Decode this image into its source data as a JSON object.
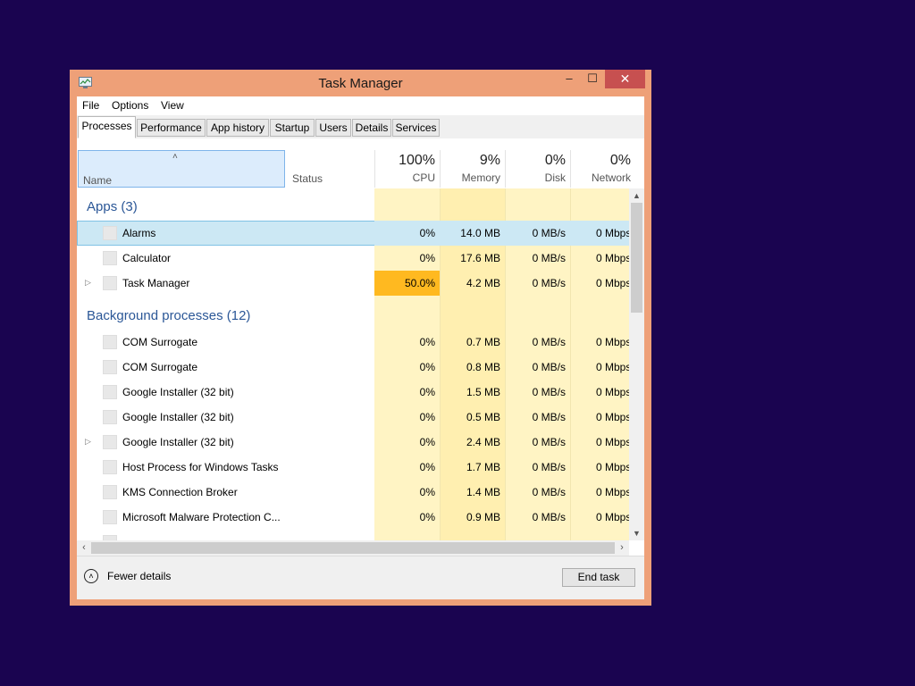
{
  "window": {
    "title": "Task Manager",
    "minimize_glyph": "‒",
    "maximize_glyph": "☐",
    "close_glyph": "✕"
  },
  "menu": [
    "File",
    "Options",
    "View"
  ],
  "tabs": [
    "Processes",
    "Performance",
    "App history",
    "Startup",
    "Users",
    "Details",
    "Services"
  ],
  "columns": {
    "name": "Name",
    "status": "Status",
    "cpu": {
      "pct": "100%",
      "label": "CPU"
    },
    "memory": {
      "pct": "9%",
      "label": "Memory"
    },
    "disk": {
      "pct": "0%",
      "label": "Disk"
    },
    "network": {
      "pct": "0%",
      "label": "Network"
    }
  },
  "groups": {
    "apps": "Apps (3)",
    "background": "Background processes (12)"
  },
  "apps": [
    {
      "name": "Alarms",
      "cpu": "0%",
      "mem": "14.0 MB",
      "disk": "0 MB/s",
      "net": "0 Mbps"
    },
    {
      "name": "Calculator",
      "cpu": "0%",
      "mem": "17.6 MB",
      "disk": "0 MB/s",
      "net": "0 Mbps"
    },
    {
      "name": "Task Manager",
      "cpu": "50.0%",
      "mem": "4.2 MB",
      "disk": "0 MB/s",
      "net": "0 Mbps"
    }
  ],
  "background": [
    {
      "name": "COM Surrogate",
      "cpu": "0%",
      "mem": "0.7 MB",
      "disk": "0 MB/s",
      "net": "0 Mbps"
    },
    {
      "name": "COM Surrogate",
      "cpu": "0%",
      "mem": "0.8 MB",
      "disk": "0 MB/s",
      "net": "0 Mbps"
    },
    {
      "name": "Google Installer (32 bit)",
      "cpu": "0%",
      "mem": "1.5 MB",
      "disk": "0 MB/s",
      "net": "0 Mbps"
    },
    {
      "name": "Google Installer (32 bit)",
      "cpu": "0%",
      "mem": "0.5 MB",
      "disk": "0 MB/s",
      "net": "0 Mbps"
    },
    {
      "name": "Google Installer (32 bit)",
      "cpu": "0%",
      "mem": "2.4 MB",
      "disk": "0 MB/s",
      "net": "0 Mbps"
    },
    {
      "name": "Host Process for Windows Tasks",
      "cpu": "0%",
      "mem": "1.7 MB",
      "disk": "0 MB/s",
      "net": "0 Mbps"
    },
    {
      "name": "KMS Connection Broker",
      "cpu": "0%",
      "mem": "1.4 MB",
      "disk": "0 MB/s",
      "net": "0 Mbps"
    },
    {
      "name": "Microsoft Malware Protection C...",
      "cpu": "0%",
      "mem": "0.9 MB",
      "disk": "0 MB/s",
      "net": "0 Mbps"
    }
  ],
  "footer": {
    "fewer_details": "Fewer details",
    "end_task": "End task"
  },
  "colors": {
    "desktop": "#1a0450",
    "window_frame": "#eea078",
    "close_button": "#c75050",
    "cpu_highlight": "#ffb920",
    "group_title": "#2b5797"
  }
}
